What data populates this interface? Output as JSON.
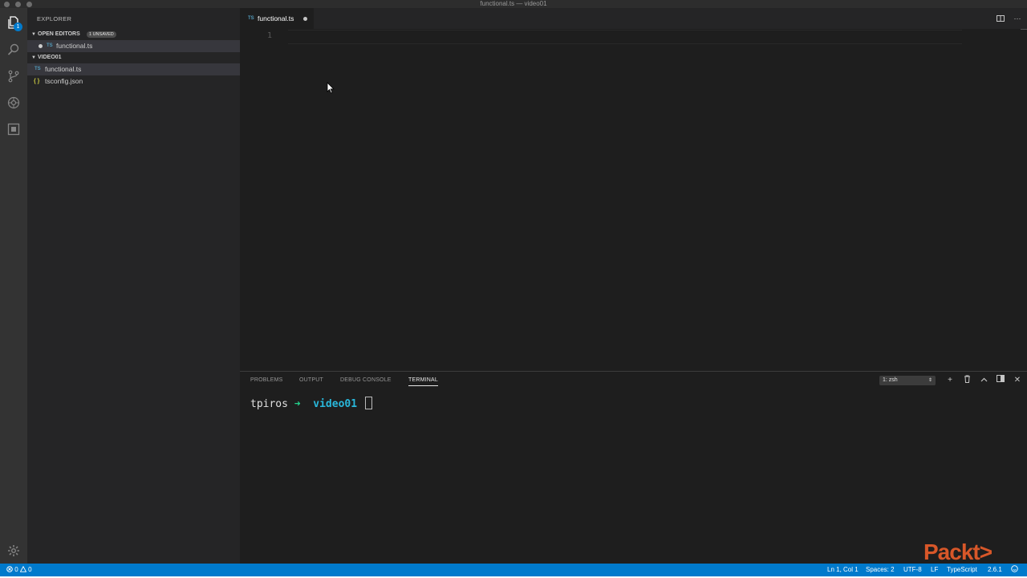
{
  "window": {
    "title": "functional.ts — video01"
  },
  "activity": {
    "explorer_badge": "1"
  },
  "sidebar": {
    "title": "EXPLORER",
    "open_editors": {
      "label": "OPEN EDITORS",
      "badge": "1 UNSAVED",
      "items": [
        {
          "name": "functional.ts",
          "icon": "TS"
        }
      ]
    },
    "folder": {
      "label": "VIDEO01",
      "items": [
        {
          "name": "functional.ts",
          "icon": "TS"
        },
        {
          "name": "tsconfig.json",
          "icon": "{ }"
        }
      ]
    }
  },
  "editor": {
    "tab": {
      "label": "functional.ts",
      "icon": "TS"
    },
    "line_number": "1"
  },
  "panel": {
    "tabs": [
      "PROBLEMS",
      "OUTPUT",
      "DEBUG CONSOLE",
      "TERMINAL"
    ],
    "shell": "1: zsh",
    "terminal": {
      "user": "tpiros",
      "arrow": "➜",
      "dir": "video01"
    }
  },
  "statusbar": {
    "errors": "0",
    "warnings": "0",
    "position": "Ln 1, Col 1",
    "spaces": "Spaces: 2",
    "encoding": "UTF-8",
    "eol": "LF",
    "language": "TypeScript",
    "version": "2.6.1"
  },
  "watermark": "Packt>",
  "colors": {
    "accent": "#007acc",
    "terminal_dir": "#29b8db",
    "terminal_arrow": "#23d18b",
    "ts_icon": "#519aba",
    "json_icon": "#cbcb41"
  }
}
